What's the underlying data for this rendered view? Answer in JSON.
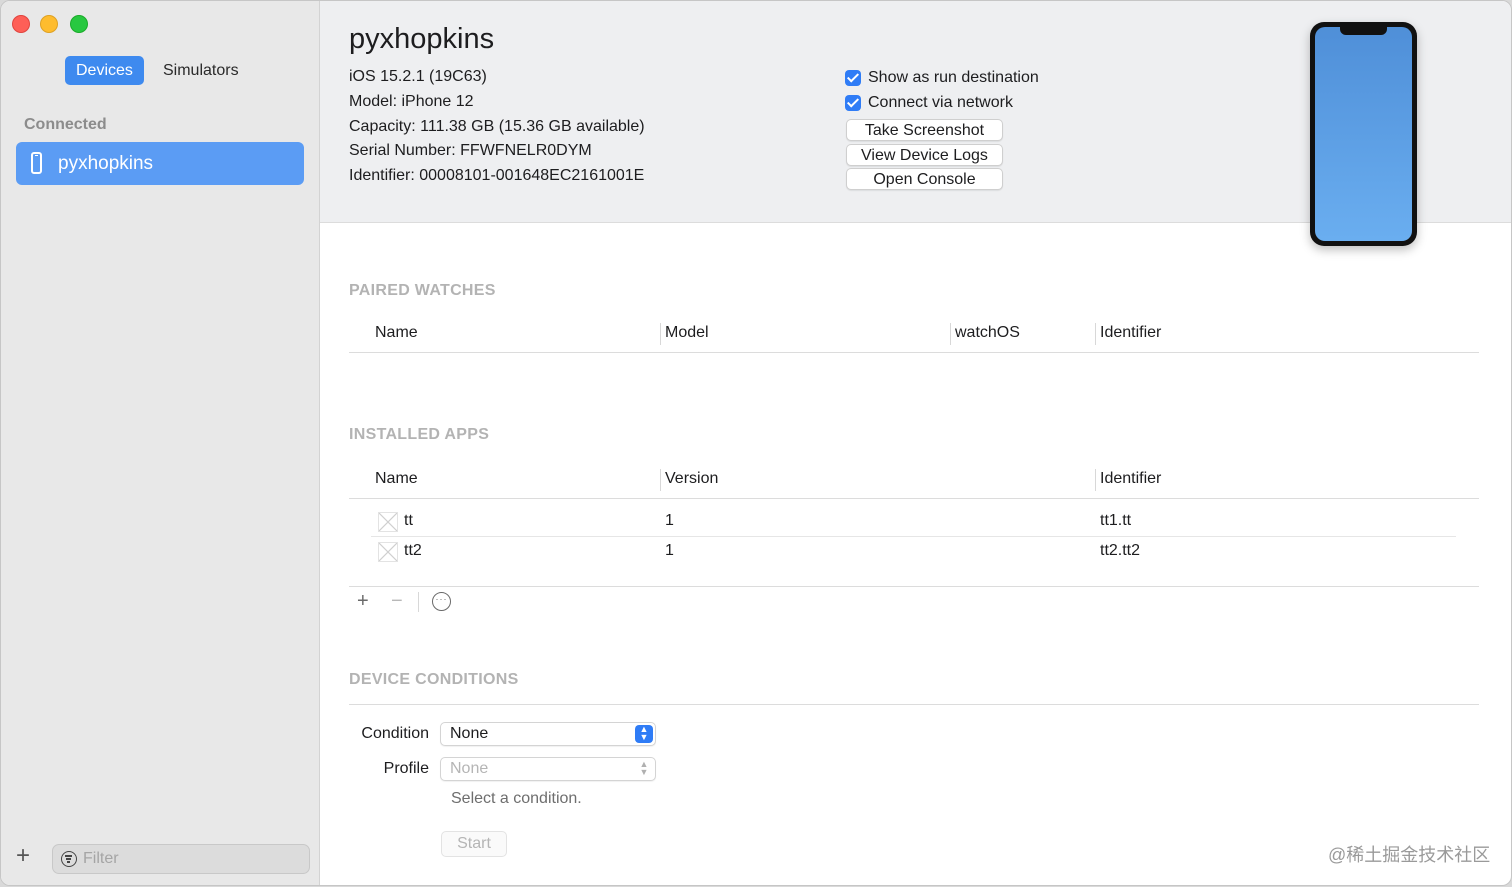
{
  "sidebar": {
    "tabs": {
      "devices": "Devices",
      "simulators": "Simulators"
    },
    "section_label": "Connected",
    "devices": [
      {
        "name": "pyxhopkins",
        "icon": "iphone-icon"
      }
    ],
    "add_button": "+",
    "filter_placeholder": "Filter"
  },
  "device": {
    "name": "pyxhopkins",
    "os": "iOS 15.2.1 (19C63)",
    "model": "Model: iPhone 12",
    "capacity": "Capacity: 111.38 GB (15.36 GB available)",
    "serial": "Serial Number: FFWFNELR0DYM",
    "identifier": "Identifier: 00008101-001648EC2161001E",
    "options": {
      "show_run_destination": {
        "label": "Show as run destination",
        "checked": true
      },
      "connect_network": {
        "label": "Connect via network",
        "checked": true
      }
    },
    "buttons": {
      "screenshot": "Take Screenshot",
      "logs": "View Device Logs",
      "console": "Open Console"
    }
  },
  "paired_watches": {
    "title": "PAIRED WATCHES",
    "columns": [
      "Name",
      "Model",
      "watchOS",
      "Identifier"
    ],
    "rows": []
  },
  "installed_apps": {
    "title": "INSTALLED APPS",
    "columns": [
      "Name",
      "Version",
      "Identifier"
    ],
    "rows": [
      {
        "name": "tt",
        "version": "1",
        "identifier": "tt1.tt"
      },
      {
        "name": "tt2",
        "version": "1",
        "identifier": "tt2.tt2"
      }
    ],
    "toolbar": {
      "add": "+",
      "remove": "−",
      "more": "···"
    }
  },
  "device_conditions": {
    "title": "DEVICE CONDITIONS",
    "condition_label": "Condition",
    "condition_value": "None",
    "profile_label": "Profile",
    "profile_value": "None",
    "hint": "Select a condition.",
    "start_button": "Start"
  },
  "watermark": "@稀土掘金技术社区",
  "colors": {
    "accent": "#2f7cf6",
    "sidebar_selection": "#5b9cf4",
    "section_title": "#b3b3b3"
  }
}
